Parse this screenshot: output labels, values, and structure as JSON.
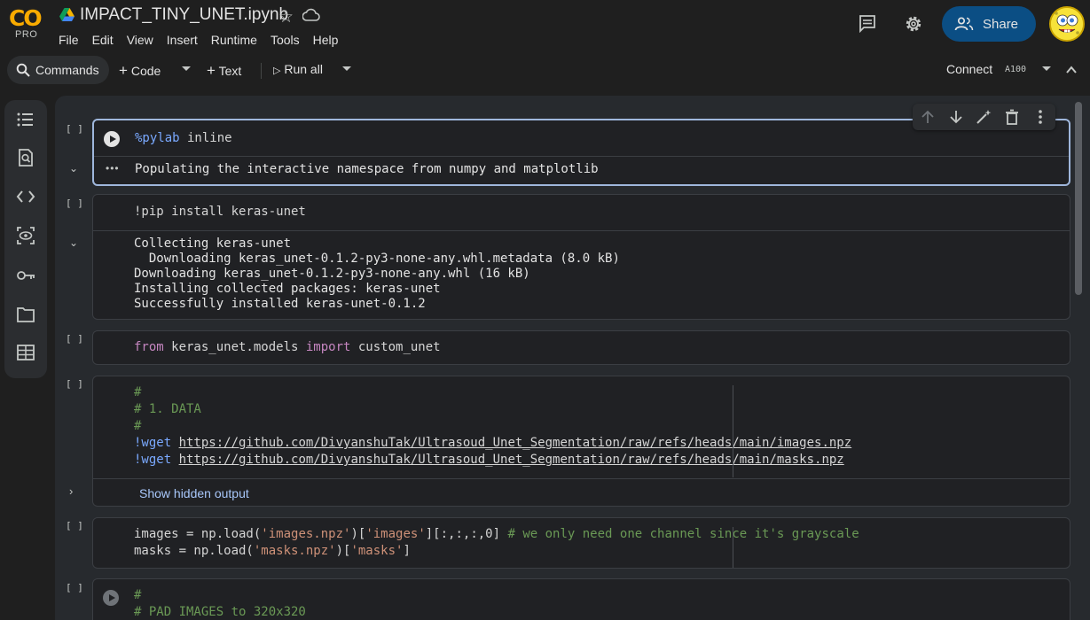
{
  "app": {
    "logo_text": "CO",
    "plan_badge": "PRO",
    "notebook_title": "IMPACT_TINY_UNET.ipynb"
  },
  "menu": [
    "File",
    "Edit",
    "View",
    "Insert",
    "Runtime",
    "Tools",
    "Help"
  ],
  "header": {
    "share_label": "Share"
  },
  "toolbar": {
    "commands_label": "Commands",
    "code_label": "Code",
    "text_label": "Text",
    "run_all_label": "Run all",
    "connect_label": "Connect",
    "runtime_type": "A100"
  },
  "cells": [
    {
      "exec_count": "[ ]",
      "code_magic": "%pylab",
      "code_rest": " inline",
      "output": "Populating the interactive namespace from numpy and matplotlib"
    },
    {
      "exec_count": "[ ]",
      "code": "!pip install keras-unet",
      "output": "Collecting keras-unet\n  Downloading keras_unet-0.1.2-py3-none-any.whl.metadata (8.0 kB)\nDownloading keras_unet-0.1.2-py3-none-any.whl (16 kB)\nInstalling collected packages: keras-unet\nSuccessfully installed keras-unet-0.1.2"
    },
    {
      "exec_count": "[ ]",
      "kw_from": "from",
      "module": " keras_unet.models ",
      "kw_import": "import",
      "name": " custom_unet"
    },
    {
      "exec_count": "[ ]",
      "line1": "#",
      "line2": "# 1. DATA",
      "line3": "#",
      "wget1_cmd": "!wget ",
      "wget1_url": "https://github.com/DivyanshuTak/Ultrasoud_Unet_Segmentation/raw/refs/heads/main/images.npz",
      "wget2_cmd": "!wget ",
      "wget2_url": "https://github.com/DivyanshuTak/Ultrasoud_Unet_Segmentation/raw/refs/heads/main/masks.npz",
      "hidden_output_label": "Show hidden output"
    },
    {
      "exec_count": "[ ]",
      "l1_a": "images = np.load(",
      "l1_s1": "'images.npz'",
      "l1_b": ")[",
      "l1_s2": "'images'",
      "l1_c": "][:,:,:,0] ",
      "l1_cmt": "# we only need one channel since it's grayscale",
      "l2_a": "masks = np.load(",
      "l2_s1": "'masks.npz'",
      "l2_b": ")[",
      "l2_s2": "'masks'",
      "l2_c": "]"
    },
    {
      "exec_count": "[ ]",
      "line1": "#",
      "line2": "# PAD IMAGES to 320x320"
    }
  ],
  "icons": {
    "rail": [
      "table-of-contents-icon",
      "find-icon",
      "code-snippets-icon",
      "variable-inspector-icon",
      "secrets-key-icon",
      "files-folder-icon",
      "data-table-icon"
    ],
    "cell_toolbar": [
      "move-up-icon",
      "move-down-icon",
      "edit-magic-icon",
      "delete-icon",
      "more-vert-icon"
    ]
  },
  "colors": {
    "accent_share": "#0b4e84",
    "logo_orange": "#f9ab00",
    "active_cell_border": "#9fb7dc",
    "string": "#ce9178",
    "comment": "#6a9955",
    "keyword_import": "#c586c0",
    "magic": "#7aa9ff"
  }
}
